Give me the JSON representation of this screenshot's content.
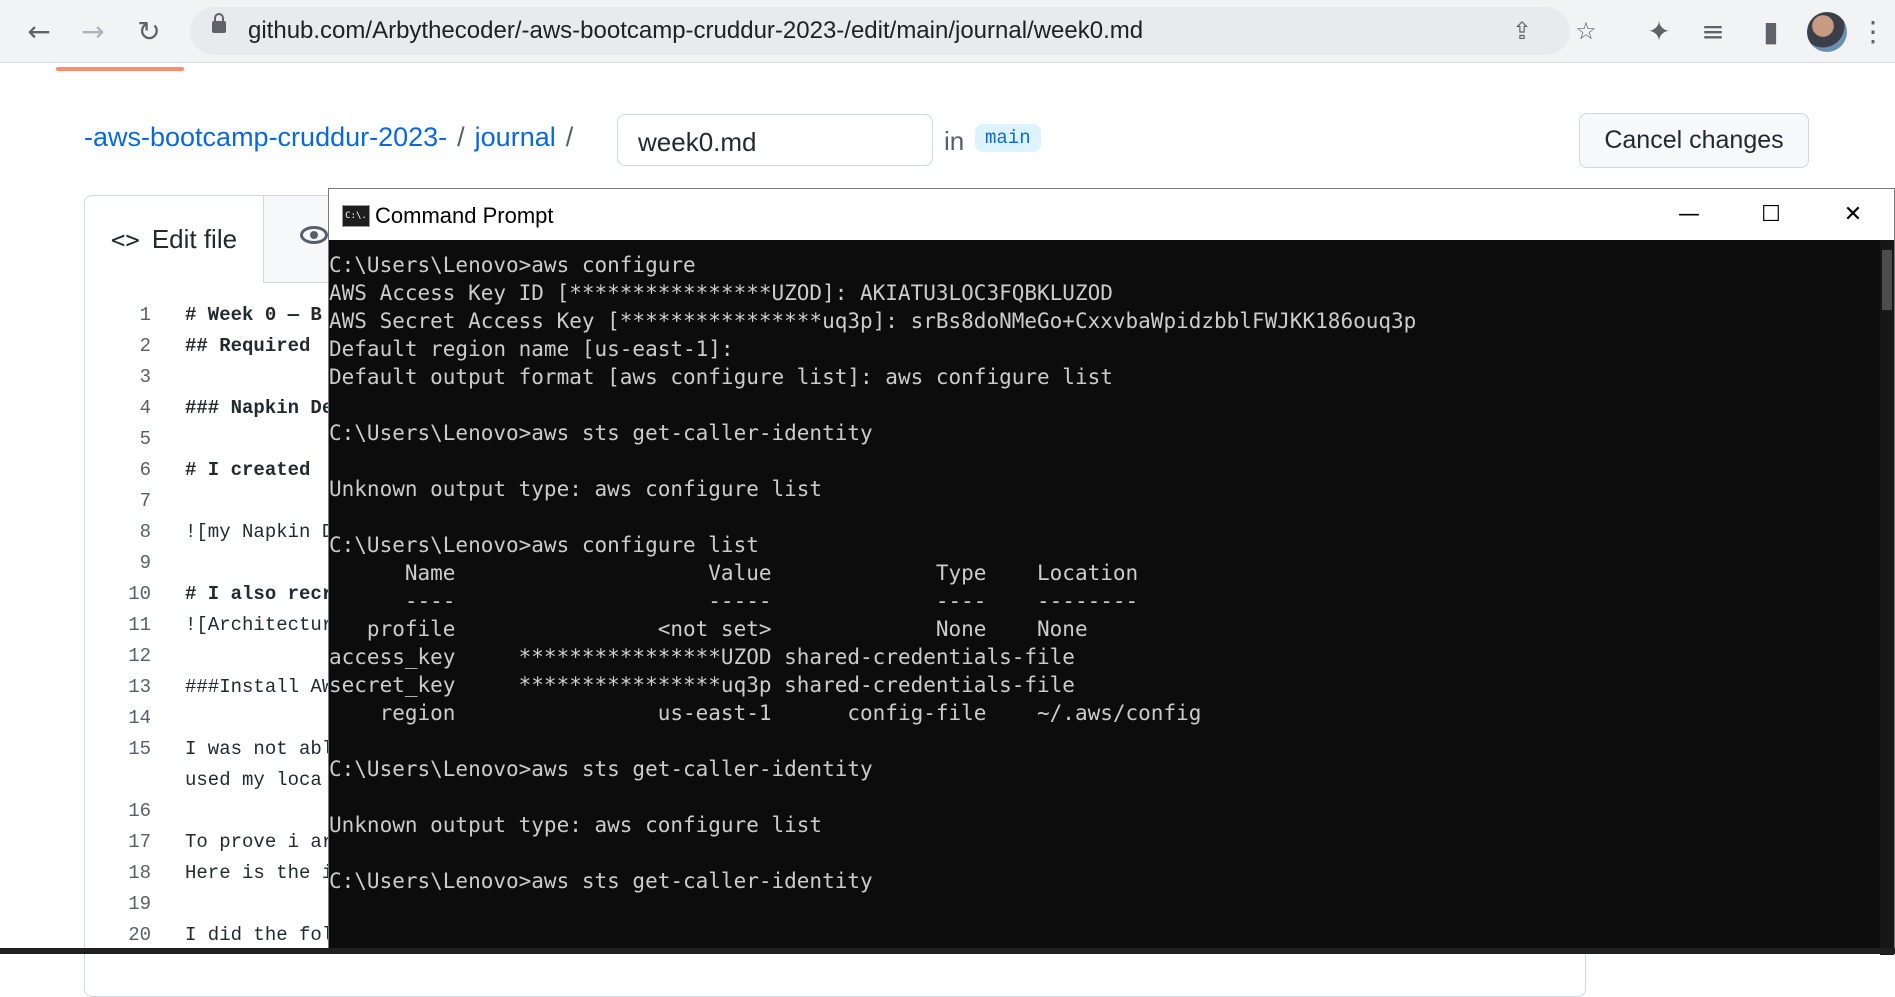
{
  "browser": {
    "url": "github.com/Arbythecoder/-aws-bootcamp-cruddur-2023-/edit/main/journal/week0.md",
    "icons": [
      "back-icon",
      "forward-icon",
      "reload-icon",
      "lock-icon",
      "share-icon",
      "star-icon",
      "extensions-icon",
      "media-icon",
      "sidepanel-icon",
      "profile-avatar",
      "menu-icon"
    ]
  },
  "github": {
    "repo_link": "-aws-bootcamp-cruddur-2023-",
    "sep1": "/",
    "folder_link": "journal",
    "sep2": "/",
    "filename": "week0.md",
    "in_label": "in",
    "branch": "main",
    "cancel_label": "Cancel changes",
    "edit_tab_label": "Edit file",
    "code_icon": "<>"
  },
  "code_lines": [
    {
      "n": "1",
      "text": "# Week 0 — B",
      "bold": true
    },
    {
      "n": "2",
      "text": "## Required ",
      "bold": true
    },
    {
      "n": "3",
      "text": "",
      "bold": false
    },
    {
      "n": "4",
      "text": "### Napkin De",
      "bold": true
    },
    {
      "n": "5",
      "text": "",
      "bold": false
    },
    {
      "n": "6",
      "text": "# I created ",
      "bold": true
    },
    {
      "n": "7",
      "text": "",
      "bold": false
    },
    {
      "n": "8",
      "text": "![my Napkin D",
      "bold": false
    },
    {
      "n": "9",
      "text": "",
      "bold": false
    },
    {
      "n": "10",
      "text": "# I also recr",
      "bold": true
    },
    {
      "n": "11",
      "text": "![Architectur",
      "bold": false
    },
    {
      "n": "12",
      "text": "",
      "bold": false
    },
    {
      "n": "13",
      "text": "###Install AW",
      "bold": false
    },
    {
      "n": "14",
      "text": "",
      "bold": false
    },
    {
      "n": "15",
      "text": "I was not abl",
      "bold": false
    },
    {
      "n": "",
      "text": "used my loca",
      "bold": false
    },
    {
      "n": "16",
      "text": "",
      "bold": false
    },
    {
      "n": "17",
      "text": "To prove i ar",
      "bold": false
    },
    {
      "n": "18",
      "text": "Here is the i",
      "bold": false
    },
    {
      "n": "19",
      "text": "",
      "bold": false
    },
    {
      "n": "20",
      "text": "I did the fol",
      "bold": false
    }
  ],
  "cmd": {
    "title": "Command Prompt",
    "icon_text": "C:\\.",
    "controls": {
      "minimize": "—",
      "maximize": "☐",
      "close": "✕"
    },
    "lines": [
      "C:\\Users\\Lenovo>aws configure",
      "AWS Access Key ID [****************UZOD]: AKIATU3LOC3FQBKLUZOD",
      "AWS Secret Access Key [****************uq3p]: 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",
      "Default region name [us-east-1]:",
      "Default output format [aws configure list]: aws configure list",
      "",
      "C:\\Users\\Lenovo>aws sts get-caller-identity",
      "",
      "Unknown output type: aws configure list",
      "",
      "C:\\Users\\Lenovo>aws configure list",
      "      Name                    Value             Type    Location",
      "      ----                    -----             ----    --------",
      "   profile                <not set>             None    None",
      "access_key     ****************UZOD shared-credentials-file",
      "secret_key     ****************uq3p shared-credentials-file",
      "    region                us-east-1      config-file    ~/.aws/config",
      "",
      "C:\\Users\\Lenovo>aws sts get-caller-identity",
      "",
      "Unknown output type: aws configure list",
      "",
      "C:\\Users\\Lenovo>aws sts get-caller-identity"
    ]
  }
}
